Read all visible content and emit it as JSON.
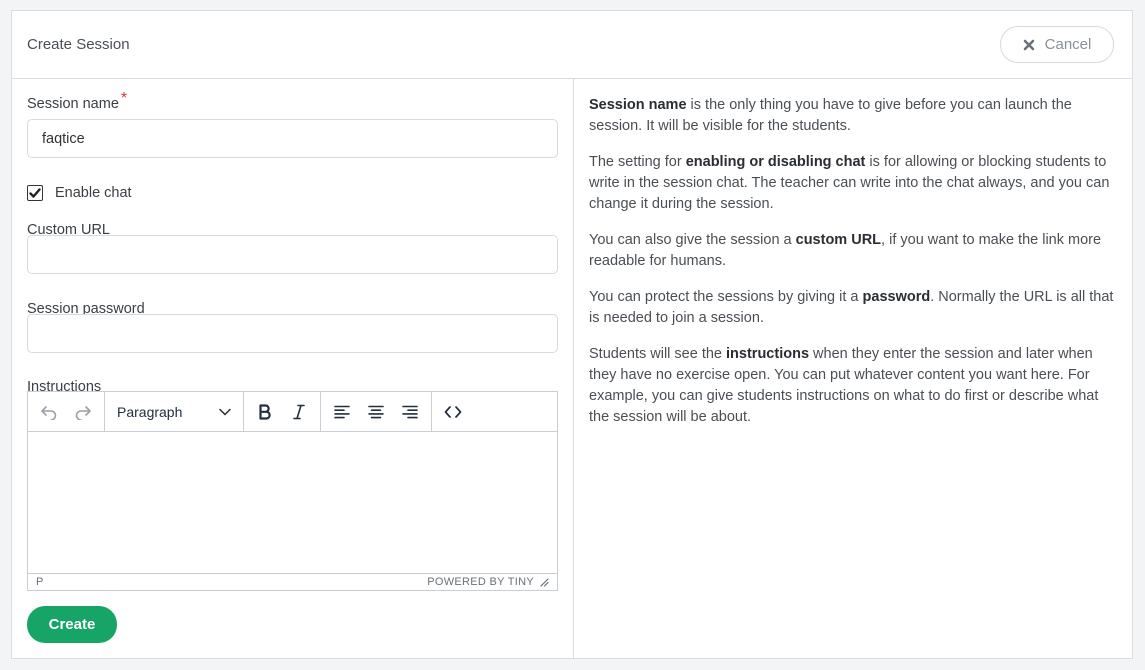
{
  "header": {
    "title": "Create Session",
    "cancel_label": "Cancel"
  },
  "form": {
    "session_name_label": "Session name",
    "required_mark": "*",
    "session_name_value": "faqtice",
    "enable_chat_label": "Enable chat",
    "enable_chat_checked": true,
    "custom_url_label": "Custom URL",
    "custom_url_value": "",
    "password_label": "Session password",
    "password_value": "",
    "instructions_label": "Instructions",
    "create_label": "Create"
  },
  "editor": {
    "format_value": "Paragraph",
    "status_path": "P",
    "branding": "POWERED BY TINY"
  },
  "help": {
    "p1": {
      "strong": "Session name",
      "rest": " is the only thing you have to give before you can launch the session. It will be visible for the students."
    },
    "p2": {
      "pre": "The setting for ",
      "strong": "enabling or disabling chat",
      "rest": " is for allowing or blocking students to write in the session chat. The teacher can write into the chat always, and you can change it during the session."
    },
    "p3": {
      "pre": "You can also give the session a ",
      "strong": "custom URL",
      "rest": ", if you want to make the link more readable for humans."
    },
    "p4": {
      "pre": "You can protect the sessions by giving it a ",
      "strong": "password",
      "rest": ". Normally the URL is all that is needed to join a session."
    },
    "p5": {
      "pre": "Students will see the ",
      "strong": "instructions",
      "rest": " when they enter the session and later when they have no exercise open. You can put whatever content you want here. For example, you can give students instructions on what to do first or describe what the session will be about."
    }
  },
  "colors": {
    "accent": "#16a567",
    "required": "#e0353b",
    "border": "#d9dde2"
  }
}
